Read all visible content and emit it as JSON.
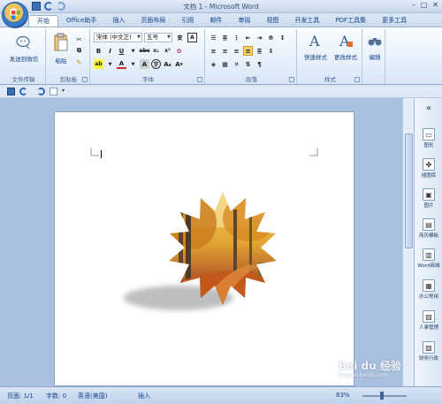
{
  "window": {
    "title": "文档 1 - Microsoft Word"
  },
  "tabs": [
    "开始",
    "Office助手",
    "插入",
    "页面布局",
    "引用",
    "邮件",
    "审阅",
    "视图",
    "开发工具",
    "PDF工具集",
    "更多工具"
  ],
  "ribbon": {
    "groups": {
      "file_transfer": {
        "label": "文件传输",
        "send_label": "发送到微信"
      },
      "clipboard": {
        "label": "剪贴板",
        "paste_label": "粘贴"
      },
      "font": {
        "label": "字体",
        "font_name": "宋体 (中文正)",
        "font_size": "五号"
      },
      "paragraph": {
        "label": "段落"
      },
      "styles": {
        "label": "样式",
        "quick_styles_label": "快速样式",
        "change_styles_label": "更改样式"
      },
      "editing": {
        "label": "",
        "edit_label": "编辑"
      }
    }
  },
  "side_panel": {
    "items": [
      {
        "label": "图形",
        "icon": "shapes-icon"
      },
      {
        "label": "插图库",
        "icon": "clipart-icon"
      },
      {
        "label": "图片",
        "icon": "picture-icon"
      },
      {
        "label": "简历模板",
        "icon": "resume-icon"
      },
      {
        "label": "Word商城",
        "icon": "store-icon"
      },
      {
        "label": "办公常用",
        "icon": "office-icon"
      },
      {
        "label": "人事管理",
        "icon": "hr-icon"
      },
      {
        "label": "财务行政",
        "icon": "finance-icon"
      }
    ]
  },
  "status": {
    "page": "页面: 1/1",
    "words": "字数: 0",
    "language": "英语(美国)",
    "mode": "插入",
    "zoom": "83%"
  },
  "watermark": {
    "brand": "Bai du 经验",
    "site": "jingyan.baidu.com"
  }
}
